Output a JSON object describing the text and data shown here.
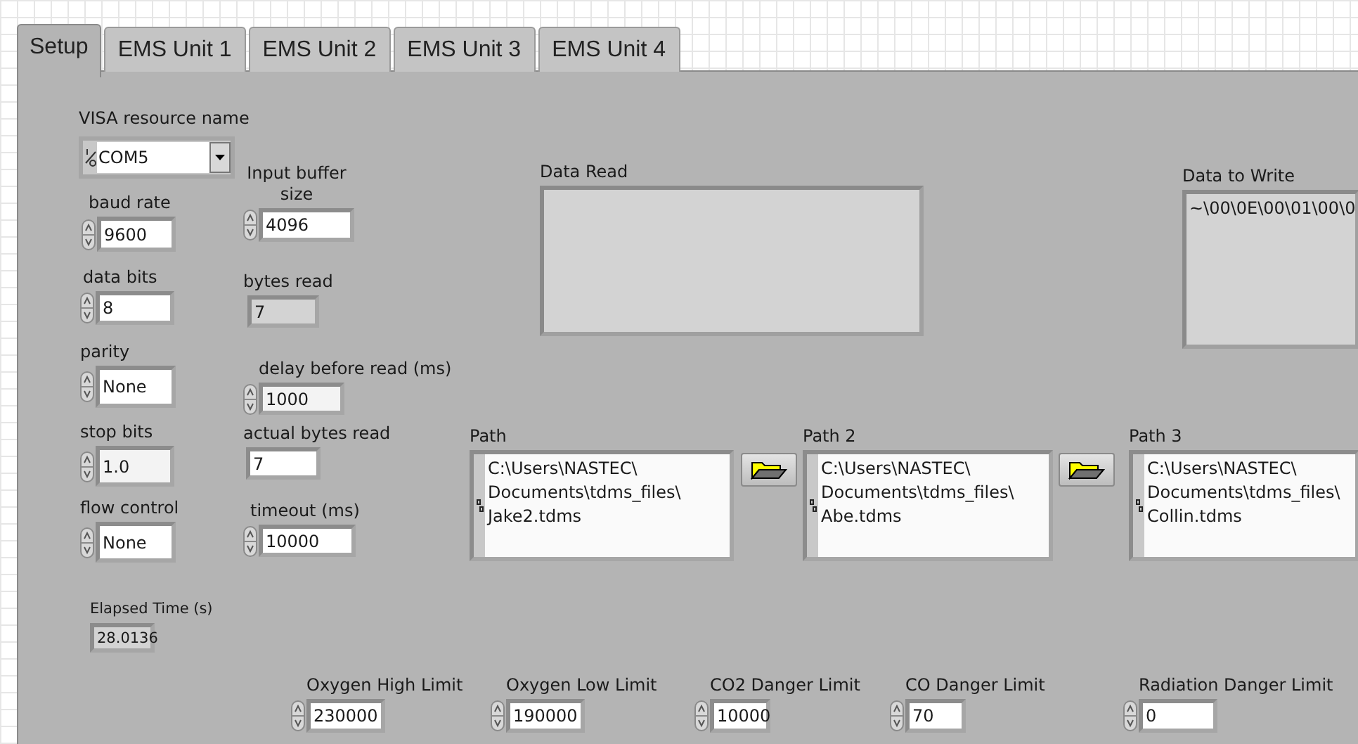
{
  "tabs": [
    {
      "label": "Setup",
      "selected": true
    },
    {
      "label": "EMS Unit 1",
      "selected": false
    },
    {
      "label": "EMS Unit 2",
      "selected": false
    },
    {
      "label": "EMS Unit 3",
      "selected": false
    },
    {
      "label": "EMS Unit 4",
      "selected": false
    }
  ],
  "visa": {
    "label": "VISA resource name",
    "value": "COM5"
  },
  "serial": [
    {
      "label": "baud rate",
      "value": "9600",
      "kind": "numeric"
    },
    {
      "label": "data bits",
      "value": "8",
      "kind": "numeric"
    },
    {
      "label": "parity",
      "value": "None",
      "kind": "numeric"
    },
    {
      "label": "stop bits",
      "value": "1.0",
      "kind": "numeric"
    },
    {
      "label": "flow control",
      "value": "None",
      "kind": "numeric"
    }
  ],
  "buffer": [
    {
      "label": "Input buffer size",
      "value": "4096",
      "kind": "numeric"
    },
    {
      "label": "bytes read",
      "value": "7",
      "kind": "indicator"
    },
    {
      "label": "delay before read (ms)",
      "value": "1000",
      "kind": "numeric"
    },
    {
      "label": "actual bytes read",
      "value": "7",
      "kind": "plain"
    },
    {
      "label": "timeout (ms)",
      "value": "10000",
      "kind": "numeric"
    }
  ],
  "elapsed": {
    "label": "Elapsed Time (s)",
    "value": "28.0136"
  },
  "data_read": {
    "label": "Data Read"
  },
  "data_to_write": {
    "label": "Data to Write",
    "value": "~\\00\\0E\\00\\01\\00\\0"
  },
  "paths": [
    {
      "label": "Path",
      "lines": [
        "C:\\Users\\NASTEC\\",
        "Documents\\tdms_files\\",
        "Jake2.tdms"
      ]
    },
    {
      "label": "Path 2",
      "lines": [
        "C:\\Users\\NASTEC\\",
        "Documents\\tdms_files\\",
        "Abe.tdms"
      ]
    },
    {
      "label": "Path 3",
      "lines": [
        "C:\\Users\\NASTEC\\",
        "Documents\\tdms_files\\",
        "Collin.tdms"
      ]
    }
  ],
  "limits": [
    {
      "label": "Oxygen High Limit",
      "value": "230000",
      "kind": "numeric"
    },
    {
      "label": "Oxygen Low Limit",
      "value": "190000",
      "kind": "numeric"
    },
    {
      "label": "CO2 Danger Limit",
      "value": "10000",
      "kind": "numeric"
    },
    {
      "label": "CO Danger Limit",
      "value": "70",
      "kind": "numeric"
    },
    {
      "label": "Radiation Danger Limit",
      "value": "0",
      "kind": "numeric"
    }
  ]
}
